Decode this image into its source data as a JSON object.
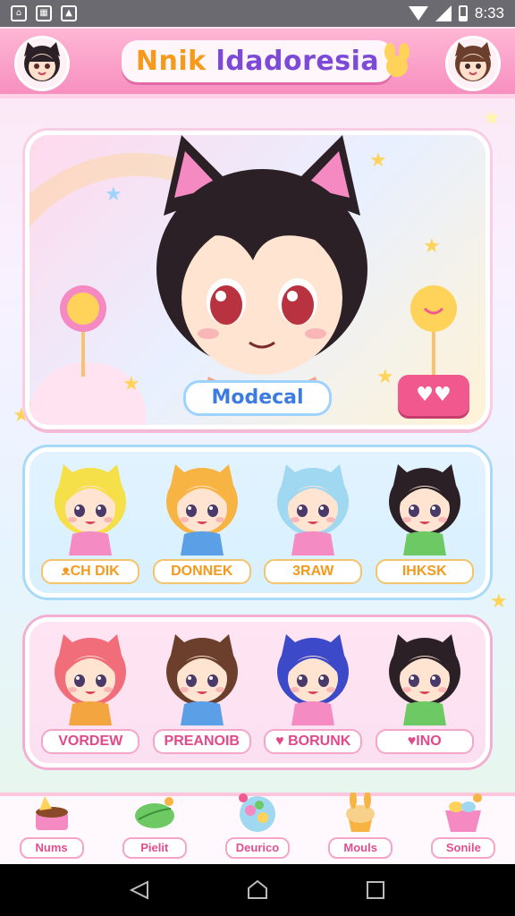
{
  "status_bar": {
    "time": "8:33",
    "left_icons": [
      "app-icon-1",
      "app-icon-2",
      "app-icon-3"
    ]
  },
  "header": {
    "title_part1": "Nnik",
    "title_part2": "ldadoresia",
    "colors": {
      "bg": "#f78fbf",
      "title1": "#f59a1b",
      "title2": "#7d4ad8"
    }
  },
  "hero": {
    "label": "Modecal",
    "button_icon": "hearts-icon"
  },
  "characters_row1": [
    {
      "name": "ᴥCH DIK",
      "hair": "#f6e04a",
      "outfit": "#f48bc2"
    },
    {
      "name": "DONNEK",
      "hair": "#f7b443",
      "outfit": "#5b9fe6"
    },
    {
      "name": "3RAW",
      "hair": "#9fd8f0",
      "outfit": "#f48bc2"
    },
    {
      "name": "IHKSK",
      "hair": "#2b2026",
      "outfit": "#6dc964"
    }
  ],
  "characters_row2": [
    {
      "name": "VORDEW",
      "hair": "#f26d7a",
      "outfit": "#f3a640"
    },
    {
      "name": "PREANOIB",
      "hair": "#6b3f2c",
      "outfit": "#5b9fe6"
    },
    {
      "name": "♥ BORUNK",
      "hair": "#3c49c9",
      "outfit": "#f48bc2"
    },
    {
      "name": "♥INO",
      "hair": "#2b2026",
      "outfit": "#6dc964"
    }
  ],
  "tabs": [
    {
      "label": "Nums",
      "icon": "cake-icon"
    },
    {
      "label": "Pielit",
      "icon": "leaf-icon"
    },
    {
      "label": "Deurico",
      "icon": "gumball-icon"
    },
    {
      "label": "Mouls",
      "icon": "muffin-icon"
    },
    {
      "label": "Sonile",
      "icon": "basket-icon"
    }
  ]
}
